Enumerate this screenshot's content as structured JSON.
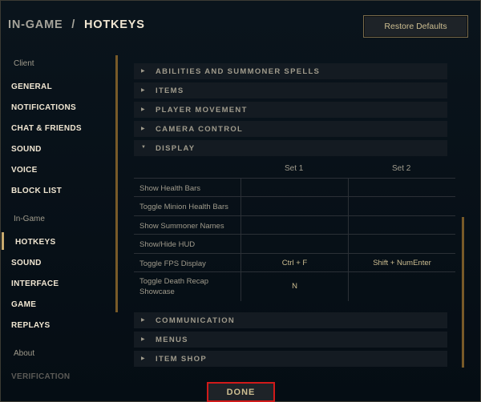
{
  "header": {
    "parent": "IN-GAME",
    "separator": "/",
    "current": "HOTKEYS",
    "restore_label": "Restore Defaults"
  },
  "sidebar": {
    "group_client": "Client",
    "client_items": [
      "GENERAL",
      "NOTIFICATIONS",
      "CHAT & FRIENDS",
      "SOUND",
      "VOICE",
      "BLOCK LIST"
    ],
    "group_ingame": "In-Game",
    "ingame_items": [
      "HOTKEYS",
      "SOUND",
      "INTERFACE",
      "GAME",
      "REPLAYS"
    ],
    "group_about": "About",
    "about_items": [
      "VERIFICATION"
    ],
    "selected": "HOTKEYS"
  },
  "sections_top": [
    "ABILITIES AND SUMMONER SPELLS",
    "ITEMS",
    "PLAYER MOVEMENT",
    "CAMERA CONTROL"
  ],
  "display": {
    "label": "DISPLAY",
    "set1_header": "Set 1",
    "set2_header": "Set 2",
    "rows": [
      {
        "label": "Show Health Bars",
        "set1": "",
        "set2": ""
      },
      {
        "label": "Toggle Minion Health Bars",
        "set1": "",
        "set2": ""
      },
      {
        "label": "Show Summoner Names",
        "set1": "",
        "set2": ""
      },
      {
        "label": "Show/Hide HUD",
        "set1": "",
        "set2": ""
      },
      {
        "label": "Toggle FPS Display",
        "set1": "Ctrl + F",
        "set2": "Shift + NumEnter"
      },
      {
        "label": "Toggle Death Recap Showcase",
        "set1": "N",
        "set2": ""
      }
    ]
  },
  "sections_bottom": [
    "COMMUNICATION",
    "MENUS",
    "ITEM SHOP"
  ],
  "footer": {
    "done_label": "DONE"
  },
  "icons": {
    "collapsed": "chevron-right-icon",
    "expanded": "chevron-down-icon"
  },
  "colors": {
    "accent_gold": "#c8aa6e",
    "highlight_red": "#d11a1a",
    "background": "#010a13"
  }
}
